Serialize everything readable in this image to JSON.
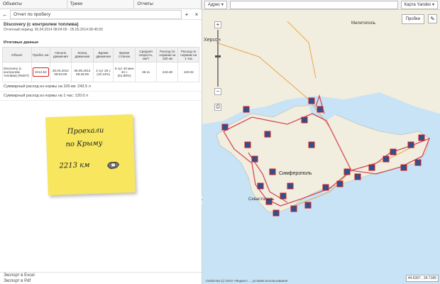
{
  "tabs": [
    "Объекты",
    "Треки",
    "Отчеты"
  ],
  "report": {
    "title": "Отчет по пробегу",
    "object_name": "Discovery (с контролем топлива)",
    "period": "Отчетный период: 26.04.2014 08:04:00 - 05.05.2014 08:45:00",
    "section_title": "Итоговые данные",
    "columns": [
      "Объект",
      "Пробег, км",
      "Начало движения",
      "Конец движения",
      "Время движения",
      "Время стоянок",
      "Средняя скорость, км/ч",
      "Расход по нормам на 100 км",
      "Расход по нормам на 1 час"
    ],
    "row": {
      "object": "Discovery (с контролем топлива) (#6207)",
      "mileage": "2213.63",
      "start": "26.04.2014 08:04:00",
      "end": "05.05.2014 08:45:09",
      "move_time": "2 сут 26 с (10.14%)",
      "stop_time": "6 сут 40 мин 34 с (51.88%)",
      "avg_speed": "48.11",
      "rate_100": "243.48",
      "rate_1h": "120.02"
    },
    "totals": [
      "Суммарный расход из нормы на 100 км: 243.5 л",
      "Суммарный расход из нормы на 1 час: 120.0 л"
    ],
    "exports": [
      "Экспорт в Excel",
      "Экспорт в Pdf"
    ]
  },
  "note": {
    "line1": "Проехали",
    "line2": "по Крыму",
    "line3": "2213 км"
  },
  "map": {
    "address_label": "Адрес",
    "provider": "Карта Yandex",
    "routes_button": "Пробки",
    "coords": "44.5397 , 34.7185",
    "copyright": "Свойства (c) ООО «Яндекс» ... условия использования",
    "city_labels": [
      "Херсон",
      "Мелитополь",
      "Симферополь",
      "Севастополь"
    ]
  },
  "colors": {
    "accent_red": "#d21e1e",
    "route": "#d24a5a",
    "land": "#f2eedf",
    "sea": "#c8e3f5",
    "note": "#f7e65e"
  }
}
